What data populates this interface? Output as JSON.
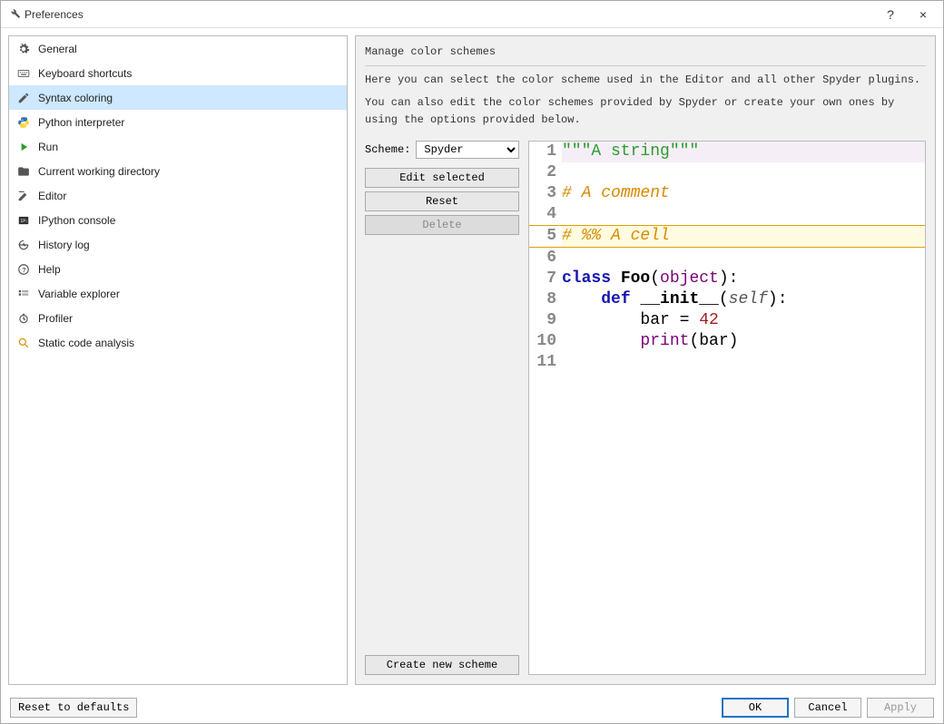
{
  "window": {
    "title": "Preferences",
    "help_btn": "?",
    "close_btn": "×"
  },
  "sidebar": {
    "items": [
      {
        "label": "General",
        "icon": "gear-icon"
      },
      {
        "label": "Keyboard shortcuts",
        "icon": "keyboard-icon"
      },
      {
        "label": "Syntax coloring",
        "icon": "pencil-icon",
        "selected": true
      },
      {
        "label": "Python interpreter",
        "icon": "python-icon"
      },
      {
        "label": "Run",
        "icon": "play-icon"
      },
      {
        "label": "Current working directory",
        "icon": "folder-icon"
      },
      {
        "label": "Editor",
        "icon": "edit-icon"
      },
      {
        "label": "IPython console",
        "icon": "ipython-icon"
      },
      {
        "label": "History log",
        "icon": "history-icon"
      },
      {
        "label": "Help",
        "icon": "help-icon"
      },
      {
        "label": "Variable explorer",
        "icon": "variables-icon"
      },
      {
        "label": "Profiler",
        "icon": "profiler-icon"
      },
      {
        "label": "Static code analysis",
        "icon": "analysis-icon"
      }
    ]
  },
  "panel": {
    "heading": "Manage color schemes",
    "desc1": "Here you can select the color scheme used in the Editor and all other Spyder plugins.",
    "desc2": "You can also edit the color schemes provided by Spyder or create your own ones by using the options provided below.",
    "scheme_label": "Scheme:",
    "scheme_value": "Spyder",
    "edit_btn": "Edit selected",
    "reset_btn": "Reset",
    "delete_btn": "Delete",
    "create_btn": "Create new scheme"
  },
  "code": {
    "lines": [
      "\"\"\"A string\"\"\"",
      "",
      "# A comment",
      "",
      "# %% A cell",
      "",
      "class Foo(object):",
      "    def __init__(self):",
      "        bar = 42",
      "        print(bar)",
      ""
    ]
  },
  "footer": {
    "reset": "Reset to defaults",
    "ok": "OK",
    "cancel": "Cancel",
    "apply": "Apply"
  }
}
